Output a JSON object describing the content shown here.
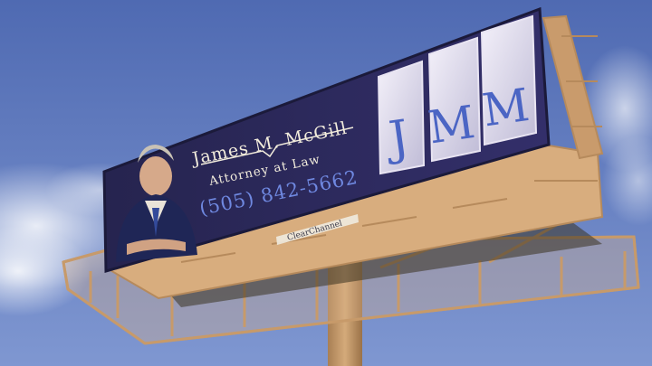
{
  "billboard": {
    "name_line": "James M. McGill",
    "title_line": "Attorney at Law",
    "phone": "(505) 842-5662",
    "monogram": [
      "J",
      "M",
      "M"
    ],
    "operator_plate": "ClearChannel"
  },
  "colors": {
    "sky_top": "#5a74b8",
    "sky_bottom": "#7b93cf",
    "billboard_face": "#2b2a5e",
    "text_cream": "#f2ecdc",
    "phone_blue": "#6f88e0",
    "frame_tan": "#c79a6a"
  }
}
